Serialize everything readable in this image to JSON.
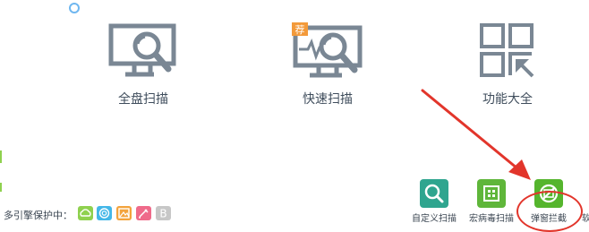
{
  "features": [
    {
      "label": "全盘扫描",
      "icon": "monitor-search-icon"
    },
    {
      "label": "快速扫描",
      "icon": "monitor-pulse-search-icon",
      "badge": "荐"
    },
    {
      "label": "功能大全",
      "icon": "grid-apps-icon"
    }
  ],
  "protection": {
    "label": "多引擎保护中：",
    "engines": [
      {
        "name": "cloud-engine-icon",
        "color": "#8fd14f"
      },
      {
        "name": "spiral-engine-icon",
        "color": "#43b7e8"
      },
      {
        "name": "image-engine-icon",
        "color": "#f3a33c"
      },
      {
        "name": "pen-engine-icon",
        "color": "#ef6a8a"
      },
      {
        "name": "b-engine-icon",
        "color": "#c7c7c7",
        "text": "B"
      }
    ]
  },
  "tools": [
    {
      "label": "自定义扫描",
      "icon": "custom-scan-icon"
    },
    {
      "label": "宏病毒扫描",
      "icon": "macro-virus-icon"
    },
    {
      "label": "弹窗拦截",
      "icon": "popup-block-icon"
    }
  ],
  "trailing_text": "软",
  "colors": {
    "icon_gray": "#7a8794",
    "highlight_red": "#e2352b",
    "badge_orange": "#f39a3a"
  }
}
